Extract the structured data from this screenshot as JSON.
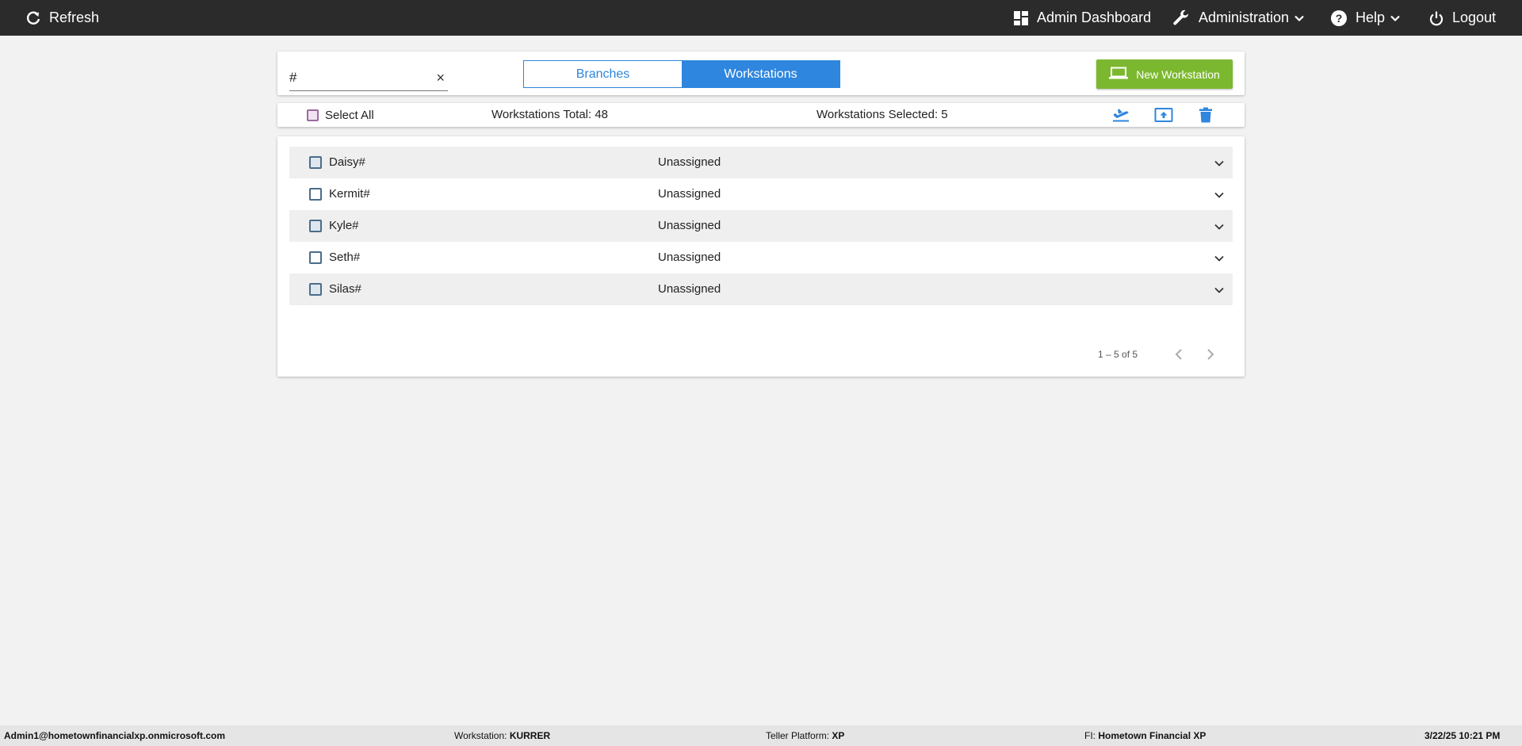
{
  "topbar": {
    "refresh_label": "Refresh",
    "admin_dashboard_label": "Admin Dashboard",
    "administration_label": "Administration",
    "help_label": "Help",
    "logout_label": "Logout"
  },
  "search": {
    "value": "#",
    "clear_icon": "×"
  },
  "view_toggle": {
    "branches_label": "Branches",
    "workstations_label": "Workstations",
    "active": "Workstations"
  },
  "new_workstation_label": "New Workstation",
  "selection_bar": {
    "select_all_label": "Select All",
    "total_text": "Workstations Total: 48",
    "selected_text": "Workstations Selected: 5"
  },
  "workstations": [
    {
      "name": "Daisy#",
      "status": "Unassigned"
    },
    {
      "name": "Kermit#",
      "status": "Unassigned"
    },
    {
      "name": "Kyle#",
      "status": "Unassigned"
    },
    {
      "name": "Seth#",
      "status": "Unassigned"
    },
    {
      "name": "Silas#",
      "status": "Unassigned"
    }
  ],
  "pagination": {
    "range_text": "1 – 5 of 5"
  },
  "statusbar": {
    "user": "Admin1@hometownfinancialxp.onmicrosoft.com",
    "workstation_label": "Workstation:",
    "workstation_value": "KURRER",
    "teller_platform_label": "Teller Platform:",
    "teller_platform_value": "XP",
    "fi_label": "FI:",
    "fi_value": "Hometown Financial XP",
    "datetime": "3/22/25 10:21 PM"
  },
  "colors": {
    "accent": "#2e86de",
    "new_button": "#7cb82f",
    "topbar": "#2b2b2b"
  }
}
